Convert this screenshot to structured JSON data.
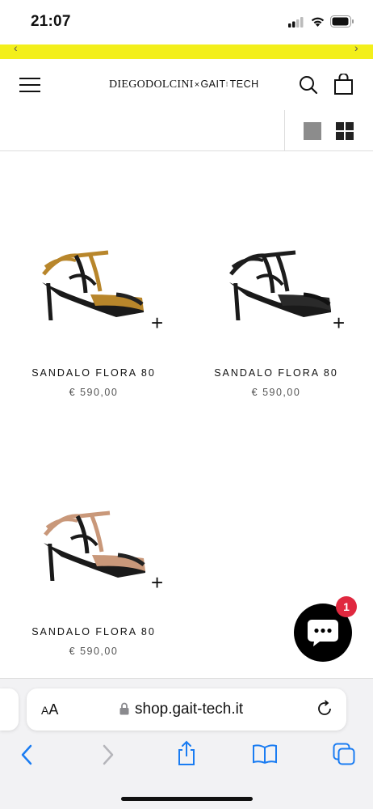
{
  "status_bar": {
    "time": "21:07"
  },
  "header": {
    "logo_part1": "DIEGODOLCINI",
    "logo_x": "×",
    "logo_part2": "GAIT",
    "logo_part3": "TECH"
  },
  "products": [
    {
      "name": "SANDALO FLORA 80",
      "price": "€ 590,00",
      "color_name": "gold",
      "strap_color": "#b8862b",
      "sole_color": "#1a1a1a"
    },
    {
      "name": "SANDALO FLORA 80",
      "price": "€ 590,00",
      "color_name": "black",
      "strap_color": "#1d1d1d",
      "sole_color": "#1a1a1a"
    },
    {
      "name": "SANDALO FLORA 80",
      "price": "€ 590,00",
      "color_name": "nude",
      "strap_color": "#c9987a",
      "sole_color": "#1a1a1a"
    }
  ],
  "chat": {
    "badge_count": "1"
  },
  "browser": {
    "text_size_label": "AA",
    "url": "shop.gait-tech.it"
  },
  "colors": {
    "promo_bar": "#f3ef1b",
    "ios_blue": "#1a7cf2",
    "badge_red": "#e0283f"
  }
}
